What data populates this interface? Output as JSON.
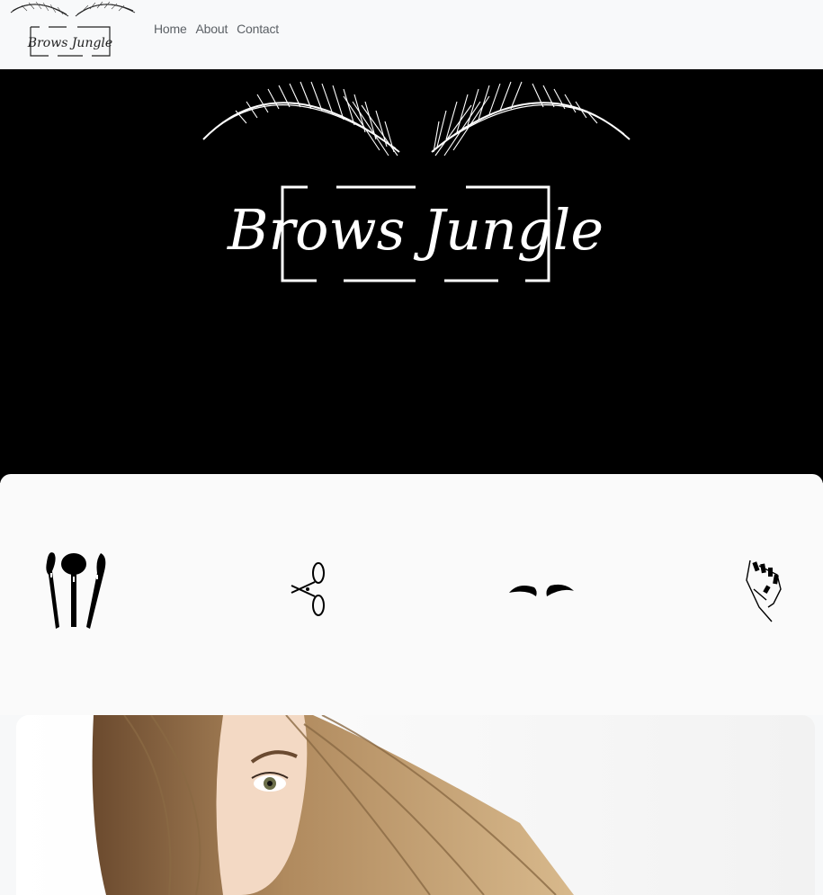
{
  "brand": {
    "logo_text": "Brows Jungle"
  },
  "nav": {
    "items": [
      {
        "label": "Home"
      },
      {
        "label": "About"
      },
      {
        "label": "Contact"
      }
    ]
  },
  "hero": {
    "logo_text": "Brows Jungle"
  },
  "services": {
    "icons": [
      {
        "name": "makeup-brushes-icon"
      },
      {
        "name": "scissors-icon"
      },
      {
        "name": "eyebrows-icon"
      },
      {
        "name": "nail-polish-hand-icon"
      }
    ]
  },
  "colors": {
    "hero_bg": "#000000",
    "nav_bg": "#f8f9fa",
    "nav_link": "#5c6166",
    "section_bg": "#fafafa"
  }
}
